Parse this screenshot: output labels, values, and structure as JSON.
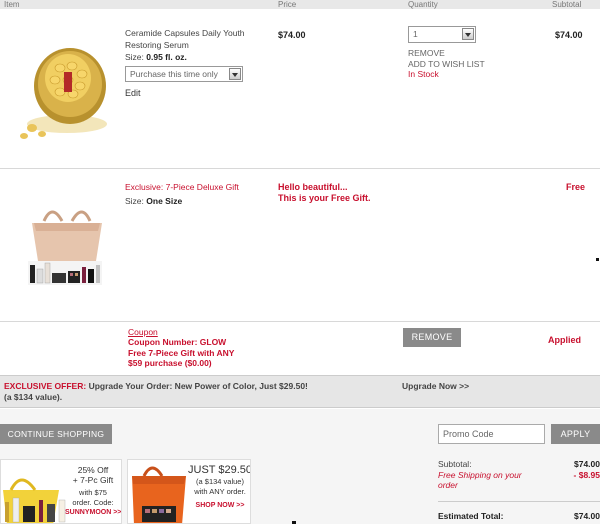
{
  "columns": {
    "item": "Item",
    "price": "Price",
    "quantity": "Quantity",
    "subtotal": "Subtotal"
  },
  "products": [
    {
      "name_line1": "Ceramide Capsules Daily Youth",
      "name_line2": "Restoring Serum",
      "size_label": "Size:",
      "size_value": "0.95 fl. oz.",
      "purchase_option": "Purchase this time only",
      "edit": "Edit",
      "price": "$74.00",
      "quantity": "1",
      "remove": "REMOVE",
      "wishlist": "ADD TO WISH LIST",
      "stock": "In Stock",
      "subtotal": "$74.00"
    },
    {
      "name": "Exclusive: 7-Piece Deluxe Gift",
      "size_label": "Size:",
      "size_value": "One Size",
      "message_line1": "Hello beautiful...",
      "message_line2": "This is your Free Gift.",
      "subtotal": "Free"
    }
  ],
  "coupon": {
    "label": "Coupon",
    "line1": "Coupon Number: GLOW",
    "line2": "Free 7-Piece Gift with ANY",
    "line3": "$59 purchase ($0.00)",
    "remove": "REMOVE",
    "status": "Applied"
  },
  "offer": {
    "label": "EXCLUSIVE OFFER:",
    "text": "Upgrade Your Order: New Power of Color, Just $29.50!",
    "text2": "(a $134 value).",
    "upgrade": "Upgrade Now >>"
  },
  "continue_shopping": "CONTINUE SHOPPING",
  "promo": {
    "placeholder": "Promo Code",
    "apply": "APPLY"
  },
  "summary": {
    "subtotal_label": "Subtotal:",
    "subtotal_value": "$74.00",
    "shipping_label_1": "Free Shipping on your",
    "shipping_label_2": "order",
    "shipping_value": "- $8.95",
    "total_label": "Estimated Total:",
    "total_value": "$74.00"
  },
  "promo_banners": [
    {
      "line1": "25% Off",
      "line2": "+ 7-Pc Gift",
      "line3": "with $75",
      "line4": "order. Code:",
      "code": "SUNNYMOON >>"
    },
    {
      "line1": "JUST $29.50",
      "line2": "(a $134 value)",
      "line3": "with ANY order.",
      "cta": "SHOP NOW >>"
    }
  ],
  "colors": {
    "accent_red": "#c8102e",
    "button_grey": "#8a8a8a"
  }
}
